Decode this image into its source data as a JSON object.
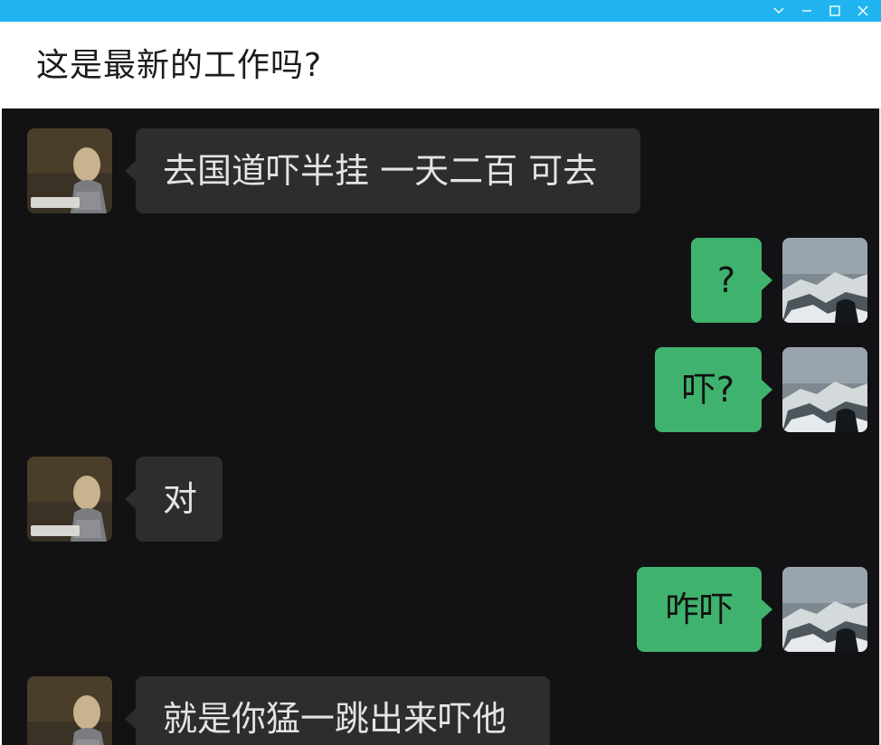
{
  "header": {
    "title": "这是最新的工作吗?"
  },
  "window_controls": [
    "chevron-down-icon",
    "minimize-icon",
    "maximize-icon",
    "close-icon"
  ],
  "colors": {
    "titlebar": "#1fb4f0",
    "chat_background": "#121113",
    "incoming_bubble": "#2d2c2e",
    "outgoing_bubble": "#3fb36e"
  },
  "messages": [
    {
      "sender": "other",
      "text": "去国道吓半挂 一天二百 可去"
    },
    {
      "sender": "me",
      "text": "?"
    },
    {
      "sender": "me",
      "text": "吓?"
    },
    {
      "sender": "other",
      "text": "对"
    },
    {
      "sender": "me",
      "text": "咋吓"
    },
    {
      "sender": "other",
      "text": "就是你猛一跳出来吓他"
    }
  ]
}
